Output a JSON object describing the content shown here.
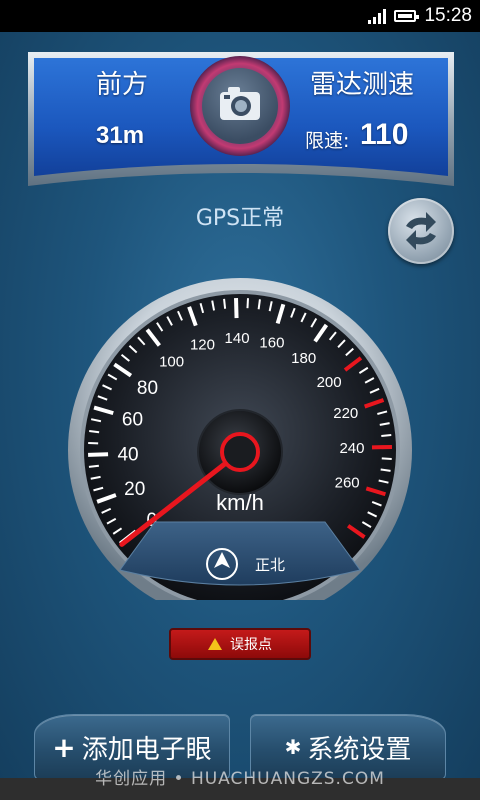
{
  "status_bar": {
    "time": "15:28"
  },
  "banner": {
    "left_title": "前方",
    "distance": "31m",
    "right_title": "雷达测速",
    "limit_label": "限速:",
    "limit_value": "110"
  },
  "gps_status": "GPS正常",
  "speedometer": {
    "unit": "km/h",
    "current_speed": 0,
    "max_speed": 280,
    "major_labels": [
      "0",
      "20",
      "40",
      "60",
      "80",
      "100",
      "120",
      "140",
      "160",
      "180",
      "200",
      "220",
      "240",
      "260"
    ],
    "direction": "正北"
  },
  "report_button": {
    "label": "误报点"
  },
  "buttons": {
    "add_camera": "添加电子眼",
    "settings": "系统设置"
  },
  "watermark": "华创应用 • HUACHUANGZS.COM",
  "colors": {
    "accent_red": "#e8161e",
    "banner_blue": "#1f62c9"
  }
}
